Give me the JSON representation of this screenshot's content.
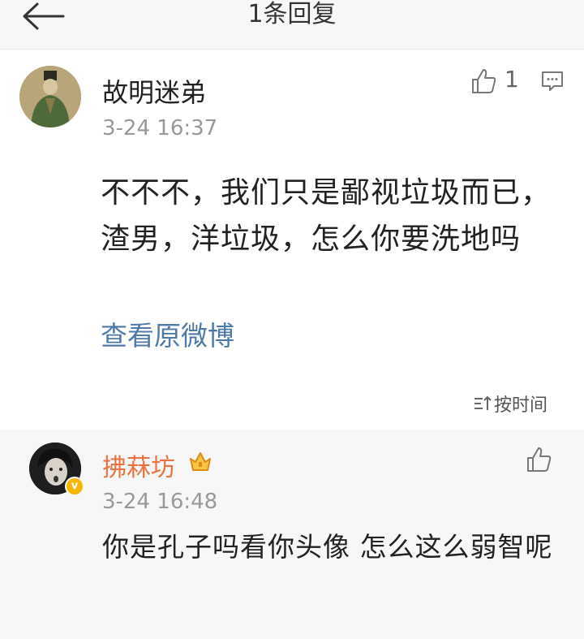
{
  "header": {
    "title": "1条回复"
  },
  "main_comment": {
    "username": "故明迷弟",
    "time": "3-24 16:37",
    "text": "不不不，我们只是鄙视垃圾而已，渣男，洋垃圾，怎么你要洗地吗",
    "like_count": "1",
    "link": "查看原微博",
    "sort_label": "按时间"
  },
  "reply": {
    "username": "拂菻坊",
    "time": "3-24 16:48",
    "text": "你是孔子吗看你头像 怎么这么弱智呢"
  },
  "colors": {
    "link": "#4f79a8",
    "vip_name": "#eb7340",
    "verified_badge": "#f5b800"
  }
}
